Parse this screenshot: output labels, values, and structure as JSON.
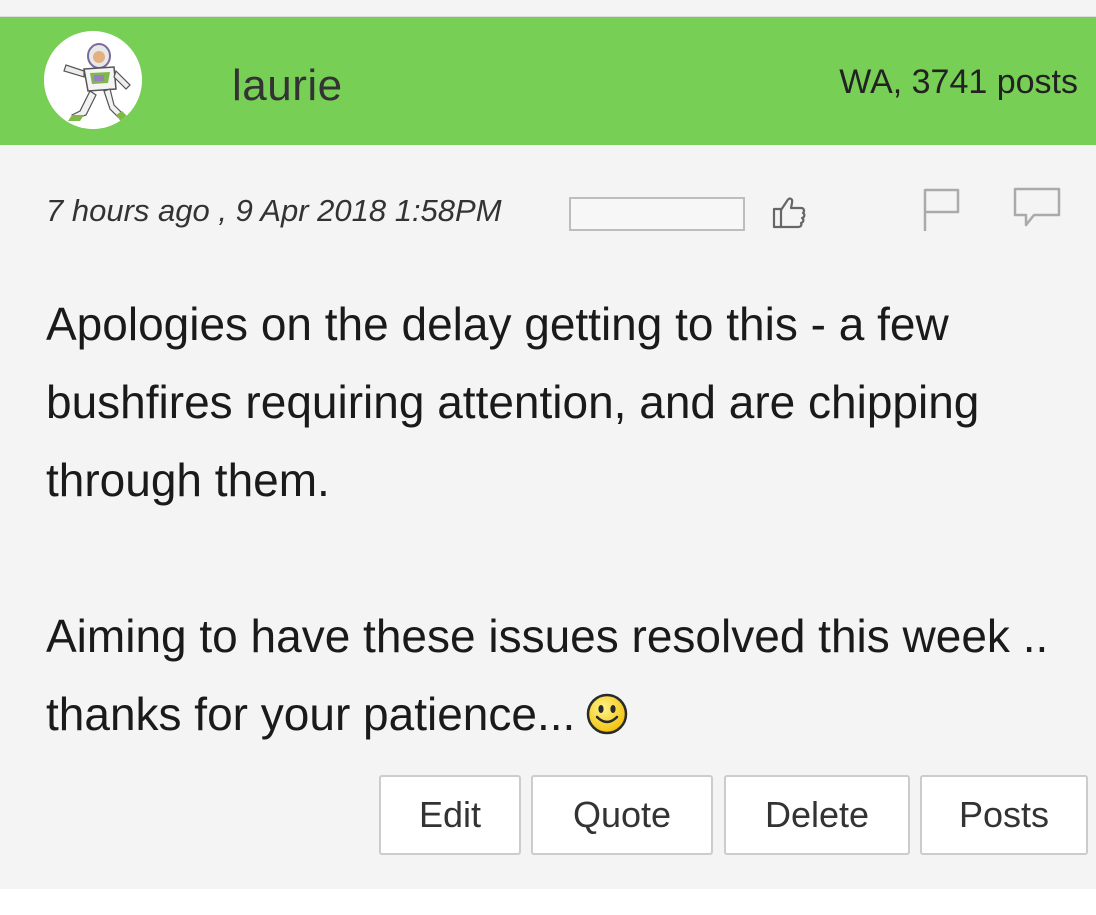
{
  "post": {
    "username": "laurie",
    "meta": "WA, 3741 posts",
    "timestamp": "7 hours ago , 9 Apr 2018 1:58PM",
    "paragraph1": "Apologies on the delay getting to this - a few bushfires requiring attention, and are chipping through them.",
    "paragraph2": "Aiming to have these issues resolved this week .. thanks for your patience..."
  },
  "icons": {
    "avatar": "avatar-buzz-lightyear",
    "like": "thumbs-up-icon",
    "flag": "flag-icon",
    "reply": "comment-icon",
    "emoji": "smiley-icon"
  },
  "actions": {
    "edit": "Edit",
    "quote": "Quote",
    "delete": "Delete",
    "posts": "Posts"
  },
  "colors": {
    "header": "#78cf55",
    "body": "#f4f4f4"
  }
}
